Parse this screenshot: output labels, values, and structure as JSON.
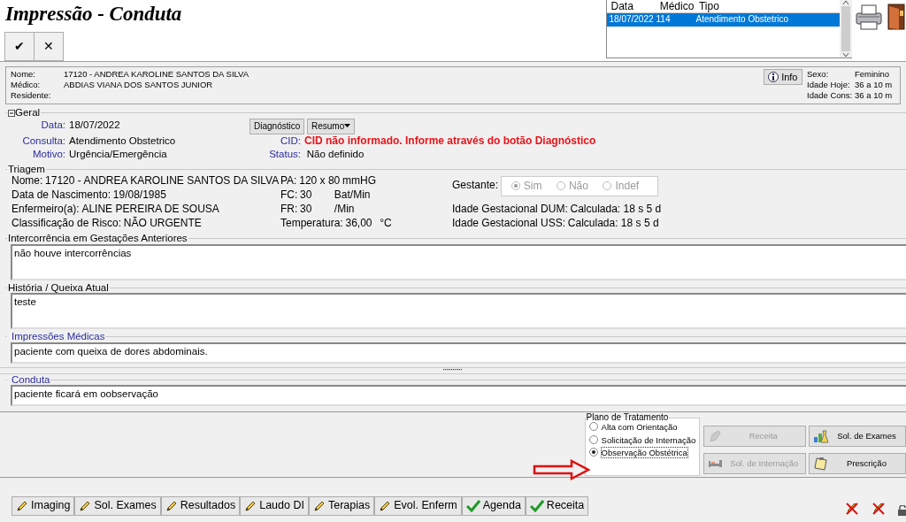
{
  "window": {
    "title": "Impressão - Conduta"
  },
  "toolbar": {
    "buttons": [
      "✔",
      "✕"
    ]
  },
  "visits": {
    "columns": [
      "Data",
      "Médico",
      "Tipo"
    ],
    "rows": [
      {
        "cells": [
          "18/07/2022",
          "114",
          "Atendimento Obstetrico"
        ],
        "selected": true
      }
    ]
  },
  "patient": {
    "fields": [
      {
        "label": "Nome:",
        "value": "17120 - ANDREA  KAROLINE SANTOS DA SILVA"
      },
      {
        "label": "Médico:",
        "value": "ABDIAS VIANA DOS SANTOS JUNIOR"
      },
      {
        "label": "Residente:"
      }
    ],
    "info_button": "Info",
    "details": [
      {
        "label": "Sexo:",
        "value": "Feminino"
      },
      {
        "label": "Idade Hoje:",
        "value": "36 a 10 m"
      },
      {
        "label": "Idade Cons:",
        "value": "36 a 10 m"
      }
    ]
  },
  "geral": {
    "title": "Geral",
    "expanded": true,
    "fields": [
      {
        "label": "Data:",
        "value": "18/07/2022"
      },
      {
        "label": "Consulta:",
        "value": "Atendimento Obstetrico"
      },
      {
        "label": "Motivo:",
        "value": "Urgência/Emergência"
      }
    ],
    "buttons": [
      {
        "label": "Diagnóstico",
        "dropdown": false
      },
      {
        "label": "Resumo",
        "dropdown": true
      }
    ],
    "cid": {
      "label": "CID:",
      "value": "CID não informado. Informe através do botão Diagnóstico"
    },
    "status": {
      "label": "Status:",
      "value": "Não definido"
    }
  },
  "triagem": {
    "title": "Triagem",
    "identity": [
      {
        "label": "Nome:",
        "value": "17120 - ANDREA  KAROLINE SANTOS DA SILVA"
      },
      {
        "label": "Data de Nascimento:",
        "value": "19/08/1985"
      },
      {
        "label": "Enfermeiro(a):",
        "value": "ALINE PEREIRA DE SOUSA"
      },
      {
        "label": "Classificação de Risco:",
        "value": "NÃO URGENTE"
      }
    ],
    "vitals": [
      {
        "label": "PA:",
        "value": "120  x 80",
        "unit": "mmHG"
      },
      {
        "label": "FC:",
        "value": "30",
        "unit": "Bat/Min"
      },
      {
        "label": "FR:",
        "value": "30",
        "unit": "/Min"
      },
      {
        "label": "Temperatura:",
        "value": "36,00",
        "unit": "°C"
      }
    ],
    "gestante": {
      "label": "Gestante:",
      "disabled": true,
      "options": [
        {
          "label": "Sim",
          "selected": true
        },
        {
          "label": "Não",
          "selected": false
        },
        {
          "label": "Indef",
          "selected": false
        }
      ]
    },
    "gestational": [
      {
        "label": "Idade Gestacional DUM:",
        "value": "Calculada: 18 s 5 d"
      },
      {
        "label": "Idade Gestacional USS:",
        "value": "Calculada: 18 s 5 d"
      }
    ]
  },
  "notes": [
    {
      "title": "Intercorrência em Gestações Anteriores",
      "value": "não houve intercorrências",
      "kind": "tall",
      "emphasized": false
    },
    {
      "title": "História / Queixa Atual",
      "value": "teste",
      "kind": "tall",
      "emphasized": false
    },
    {
      "title": "Impressões Médicas",
      "value": "paciente com queixa de dores abdominais.",
      "kind": "short",
      "emphasized": true
    },
    {
      "title": "Conduta",
      "value": "paciente ficará em oobservação",
      "kind": "short",
      "emphasized": true
    }
  ],
  "plan": {
    "title": "Plano de Tratamento",
    "options": [
      {
        "label": "Alta com Orientação",
        "selected": false
      },
      {
        "label": "Solicitação de Internação",
        "selected": false
      },
      {
        "label": "Observação Obstétrica",
        "selected": true
      }
    ],
    "actions": [
      {
        "label": "Receita",
        "disabled": true
      },
      {
        "label": "Sol. de Exames",
        "disabled": false
      },
      {
        "label": "Sol. de Internação",
        "disabled": true
      },
      {
        "label": "Prescrição",
        "disabled": false
      }
    ]
  },
  "bottom_tabs": [
    {
      "label": "Imaging",
      "kind": "edit"
    },
    {
      "label": "Sol. Exames",
      "kind": "edit"
    },
    {
      "label": "Resultados",
      "kind": "edit"
    },
    {
      "label": "Laudo DI",
      "kind": "edit"
    },
    {
      "label": "Terapias",
      "kind": "edit"
    },
    {
      "label": "Evol. Enferm",
      "kind": "edit"
    },
    {
      "label": "Agenda",
      "kind": "done"
    },
    {
      "label": "Receita",
      "kind": "done"
    }
  ]
}
